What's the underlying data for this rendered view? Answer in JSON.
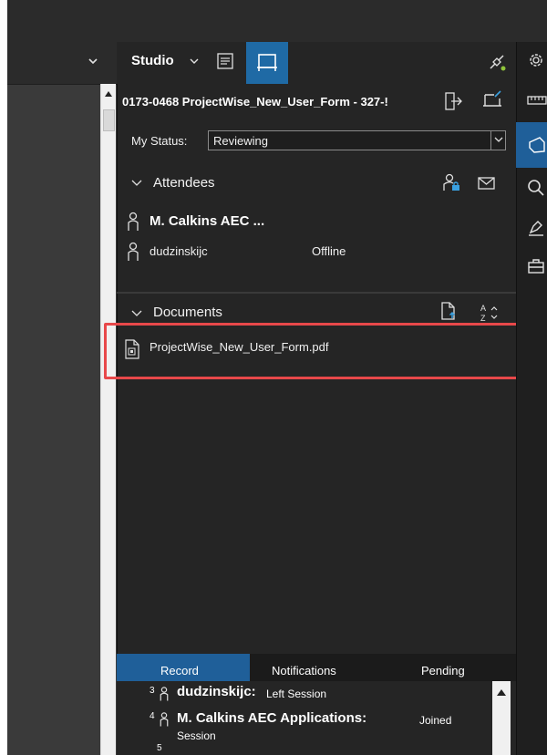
{
  "studio": {
    "title": "Studio",
    "session_title": "0173-0468 ProjectWise_New_User_Form - 327-!",
    "status_label": "My Status:",
    "status_value": "Reviewing"
  },
  "attendees": {
    "title": "Attendees",
    "items": [
      {
        "name": "M. Calkins AEC ...",
        "status": ""
      },
      {
        "name": "dudzinskijc",
        "status": "Offline"
      }
    ]
  },
  "documents": {
    "title": "Documents",
    "items": [
      {
        "name": "ProjectWise_New_User_Form.pdf"
      }
    ]
  },
  "record_panel": {
    "tabs": [
      "Record",
      "Notifications",
      "Pending"
    ],
    "active_tab": "Record",
    "entries": [
      {
        "num": "3",
        "name": "dudzinskijc:",
        "action": "Left Session"
      },
      {
        "num": "4",
        "name": "M. Calkins AEC Applications:",
        "action": "Joined",
        "action_cont": "Session"
      },
      {
        "num": "5"
      }
    ]
  },
  "icons": {
    "studio_chevron": "chevron-down-icon",
    "document_list": "document-list-icon",
    "layout": "layout-panel-icon",
    "connection": "connection-status-icon",
    "exit": "exit-session-icon",
    "present": "present-icon",
    "lock": "person-lock-icon",
    "mail": "mail-icon",
    "upload": "upload-document-icon",
    "sort": "sort-az-icon",
    "file": "pdf-file-icon",
    "rail": [
      "gear-icon",
      "measure-icon",
      "shape-icon",
      "search-icon",
      "markup-icon",
      "briefcase-icon"
    ]
  },
  "colors": {
    "accent": "#1f6aa5",
    "highlight": "#e8484a",
    "panel": "#252525",
    "connection_dot": "#8fc43a"
  }
}
